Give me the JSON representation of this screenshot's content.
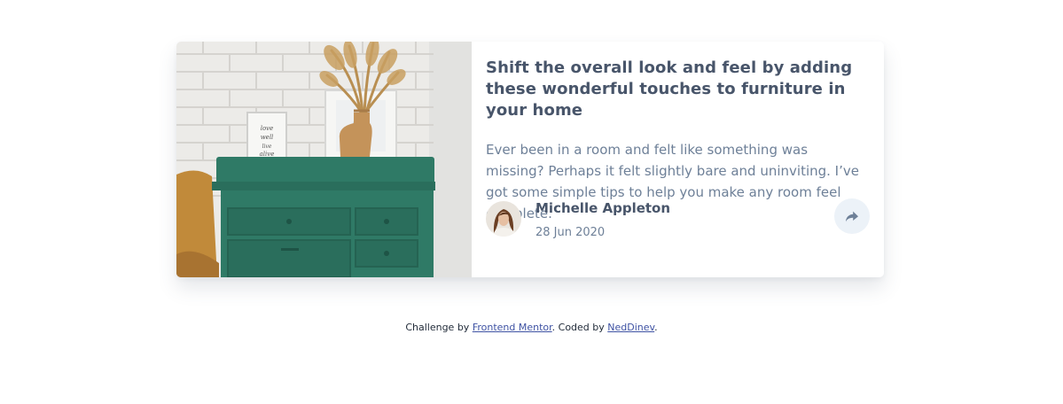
{
  "card": {
    "image_alt": "drawers",
    "title": "Shift the overall look and feel by adding these wonderful touches to furniture in your home",
    "excerpt": "Ever been in a room and felt like something was missing? Perhaps it felt slightly bare and uninviting. I’ve got some simple tips to help you make any room feel complete.",
    "author": {
      "name": "Michelle Appleton",
      "date": "28 Jun 2020"
    },
    "share_icon": "share-icon"
  },
  "attribution": {
    "prefix": "Challenge by ",
    "link1": "Frontend Mentor",
    "middle": ". Coded by ",
    "link2": "NedDinev",
    "suffix": "."
  },
  "colors": {
    "title": "#48556a",
    "text": "#6e8098",
    "share_bg": "#ecf2f8",
    "link": "#3e52a3"
  }
}
